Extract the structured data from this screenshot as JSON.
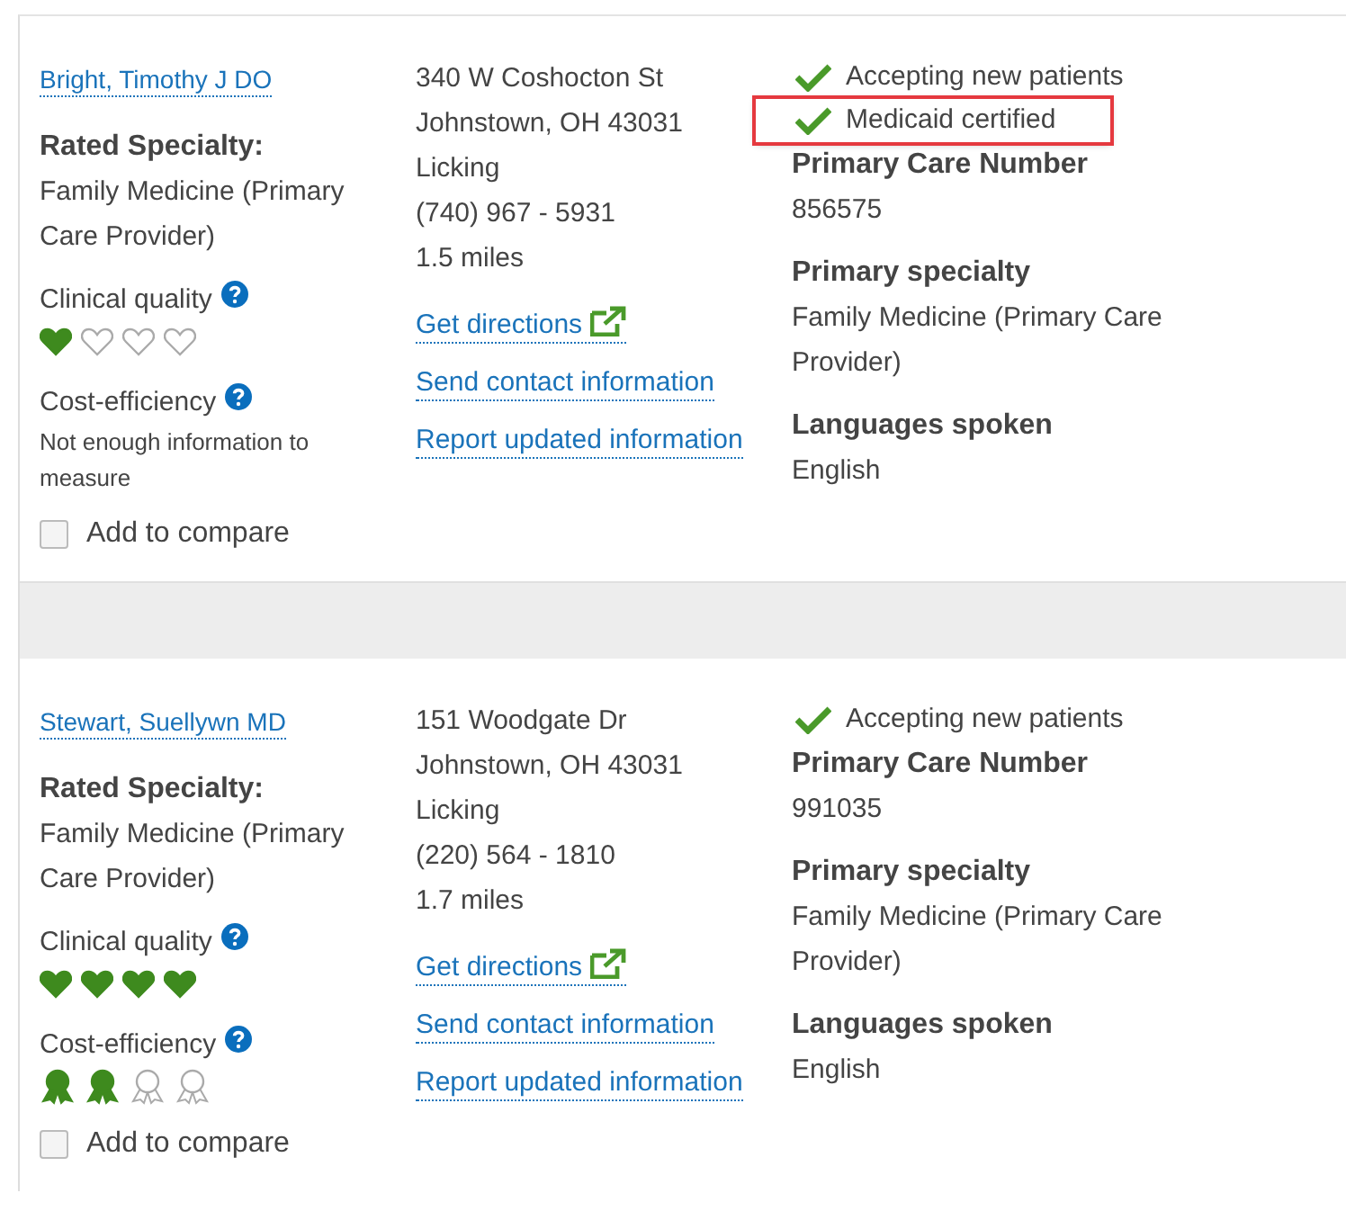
{
  "providers": [
    {
      "name": "Bright, Timothy J DO",
      "rated_specialty_label": "Rated Specialty:",
      "rated_specialty": "Family Medicine (Primary Care Provider)",
      "clinical_quality": {
        "label": "Clinical quality",
        "stars": 1
      },
      "cost_efficiency": {
        "label": "Cost-efficiency",
        "kind": "note",
        "note": "Not enough information to measure"
      },
      "compare": {
        "label": "Add to compare",
        "checked": false
      },
      "address": [
        "340 W Coshocton St",
        "Johnstown, OH 43031",
        "Licking",
        "(740) 967 - 5931",
        "1.5 miles"
      ],
      "links": [
        "Get directions",
        "Send contact information",
        "Report updated information"
      ],
      "features": [
        {
          "label": "Accepting new patients",
          "highlighted": false
        },
        {
          "label": "Medicaid certified",
          "highlighted": true
        }
      ],
      "details": [
        {
          "label": "Primary Care Number",
          "value": "856575"
        },
        {
          "label": "Primary specialty",
          "value": "Family Medicine (Primary Care Provider)"
        },
        {
          "label": "Languages spoken",
          "value": "English"
        }
      ]
    },
    {
      "name": "Stewart, Suellywn MD",
      "rated_specialty_label": "Rated Specialty:",
      "rated_specialty": "Family Medicine (Primary Care Provider)",
      "clinical_quality": {
        "label": "Clinical quality",
        "stars": 4
      },
      "cost_efficiency": {
        "label": "Cost-efficiency",
        "kind": "rating",
        "stars": 2
      },
      "compare": {
        "label": "Add to compare",
        "checked": false
      },
      "address": [
        "151 Woodgate Dr",
        "Johnstown, OH 43031",
        "Licking",
        "(220) 564 - 1810",
        "1.7 miles"
      ],
      "links": [
        "Get directions",
        "Send contact information",
        "Report updated information"
      ],
      "features": [
        {
          "label": "Accepting new patients",
          "highlighted": false
        }
      ],
      "details": [
        {
          "label": "Primary Care Number",
          "value": "991035"
        },
        {
          "label": "Primary specialty",
          "value": "Family Medicine (Primary Care Provider)"
        },
        {
          "label": "Languages spoken",
          "value": "English"
        }
      ]
    }
  ]
}
